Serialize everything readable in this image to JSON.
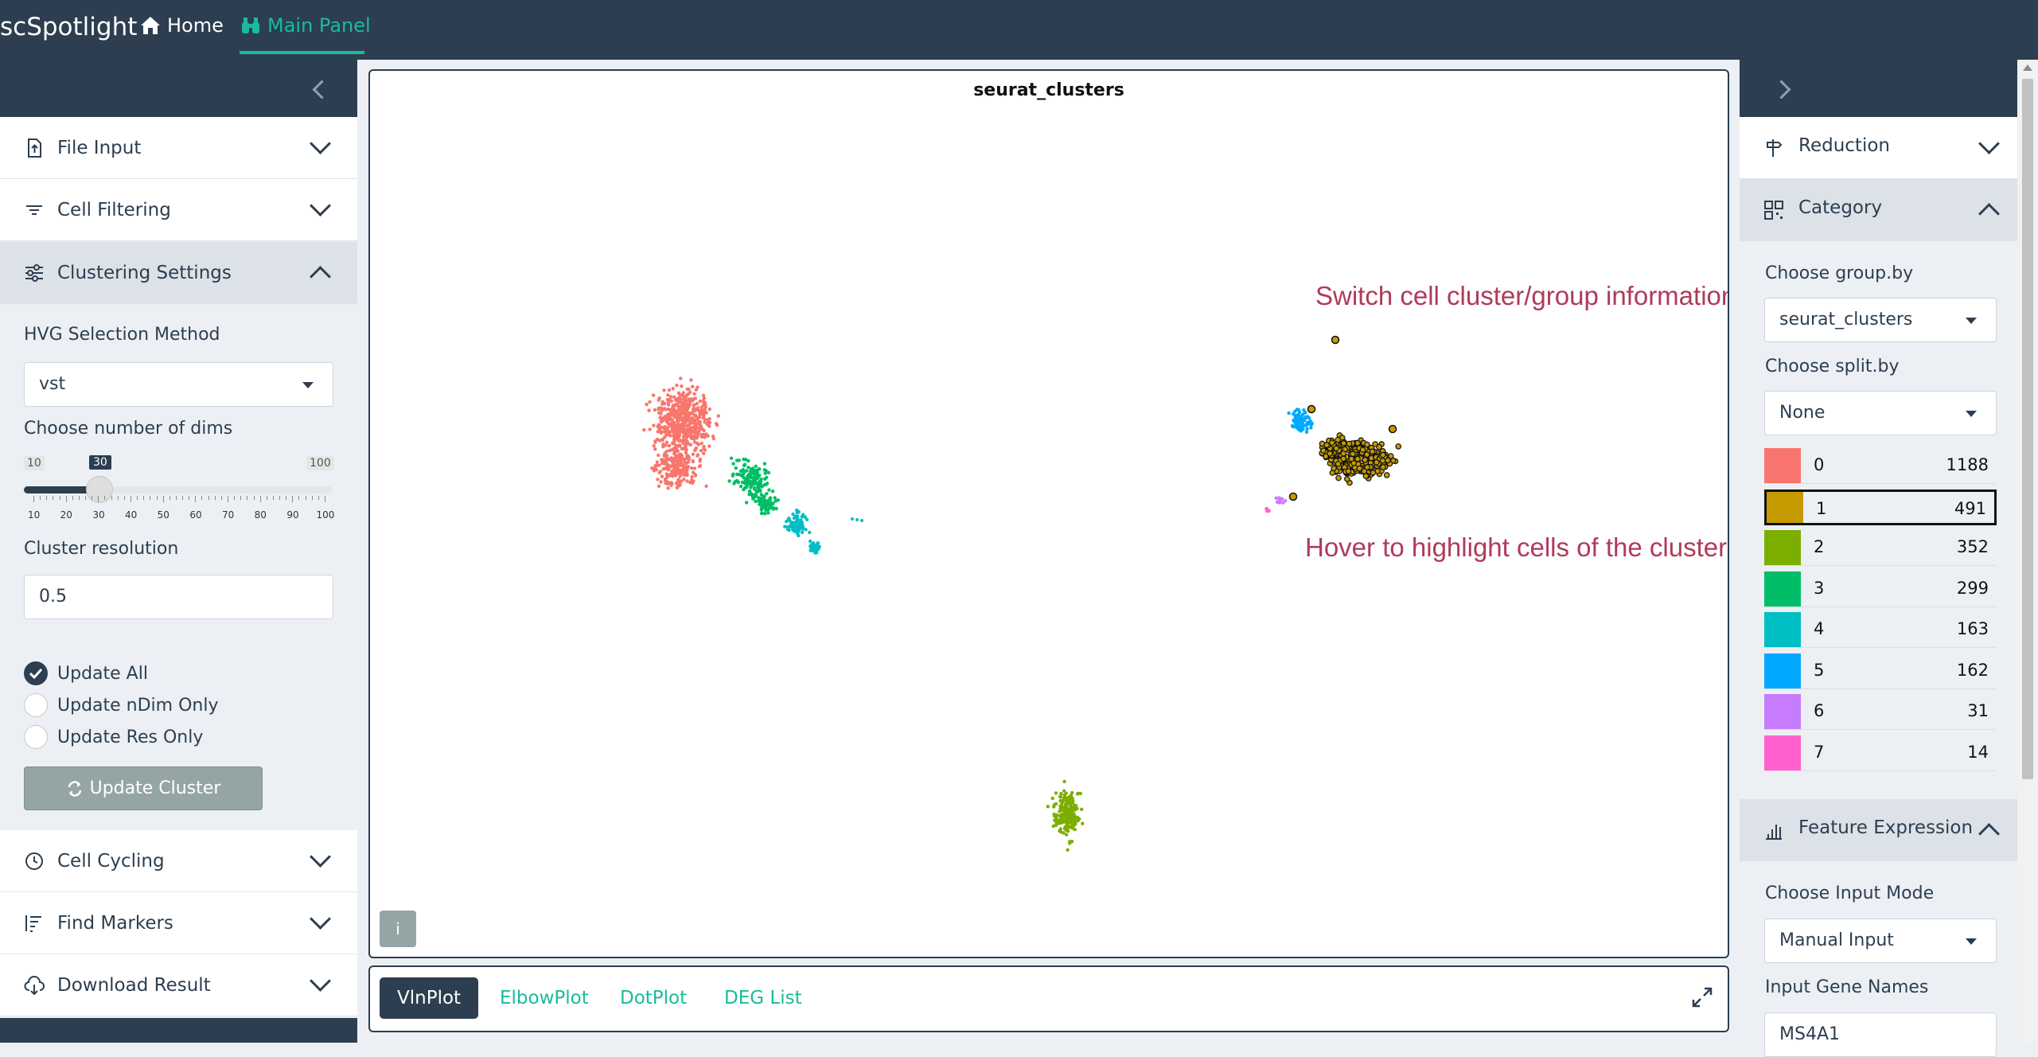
{
  "navbar": {
    "brand": "scSpotlight",
    "home_label": "Home",
    "main_panel_label": "Main Panel"
  },
  "left_sidebar": {
    "sections": [
      {
        "label": "File Input",
        "icon": "file-upload-icon"
      },
      {
        "label": "Cell Filtering",
        "icon": "filter-icon"
      },
      {
        "label": "Clustering Settings",
        "icon": "sliders-icon"
      }
    ],
    "clustering": {
      "hvg_label": "HVG Selection Method",
      "hvg_value": "vst",
      "dims_label": "Choose number of dims",
      "dims_min": "10",
      "dims_max": "100",
      "dims_value": "30",
      "dims_ticks": [
        "10",
        "20",
        "30",
        "40",
        "50",
        "60",
        "70",
        "80",
        "90",
        "100"
      ],
      "resolution_label": "Cluster resolution",
      "resolution_value": "0.5",
      "radio_options": [
        "Update All",
        "Update nDim Only",
        "Update Res Only"
      ],
      "radio_selected": "Update All",
      "update_button": "Update Cluster"
    },
    "bottom_sections": [
      {
        "label": "Cell Cycling",
        "icon": "clock-icon"
      },
      {
        "label": "Find Markers",
        "icon": "sort-list-icon"
      },
      {
        "label": "Download Result",
        "icon": "cloud-download-icon"
      }
    ]
  },
  "plot": {
    "title": "seurat_clusters",
    "annotation_switch": "Switch cell cluster/group information",
    "annotation_hover": "Hover to highlight cells of the cluster",
    "info_button": "i"
  },
  "tabs": [
    "VlnPlot",
    "ElbowPlot",
    "DotPlot",
    "DEG List"
  ],
  "active_tab": "VlnPlot",
  "right_sidebar": {
    "reduction_label": "Reduction",
    "category_label": "Category",
    "groupby_label": "Choose group.by",
    "groupby_value": "seurat_clusters",
    "splitby_label": "Choose split.by",
    "splitby_value": "None",
    "clusters": [
      {
        "name": "0",
        "count": "1188",
        "color": "#f8766d"
      },
      {
        "name": "1",
        "count": "491",
        "color": "#c49a00"
      },
      {
        "name": "2",
        "count": "352",
        "color": "#7cae00"
      },
      {
        "name": "3",
        "count": "299",
        "color": "#00be67"
      },
      {
        "name": "4",
        "count": "163",
        "color": "#00bfc4"
      },
      {
        "name": "5",
        "count": "162",
        "color": "#00a9ff"
      },
      {
        "name": "6",
        "count": "31",
        "color": "#c77cff"
      },
      {
        "name": "7",
        "count": "14",
        "color": "#ff61cc"
      }
    ],
    "hovered_cluster": "1",
    "feature_label": "Feature Expression",
    "input_mode_label": "Choose Input Mode",
    "input_mode_value": "Manual Input",
    "gene_names_label": "Input Gene Names",
    "gene_names_value": "MS4A1"
  },
  "colors": {
    "navbar": "#2c3e50",
    "accent": "#18bc9c",
    "annotation": "#b03a5b"
  }
}
